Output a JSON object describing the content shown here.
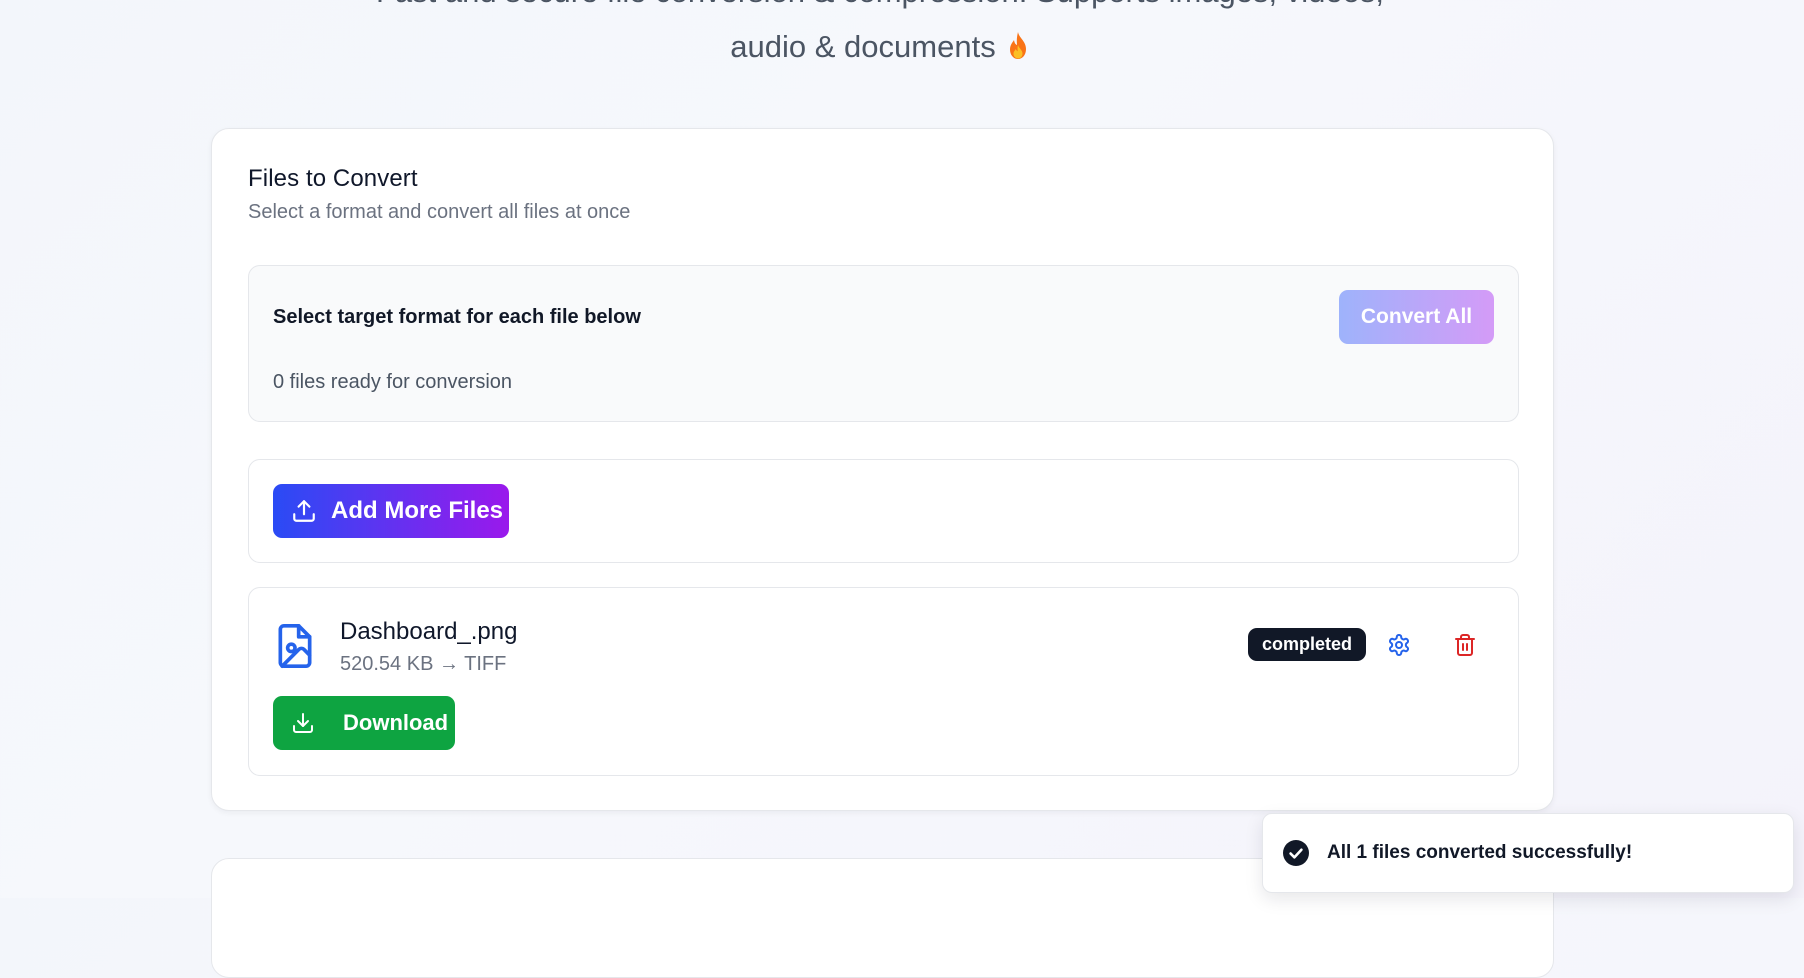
{
  "hero": {
    "subtitle_line1": "Fast and secure file conversion & compression. Supports images, videos,",
    "subtitle_line2": "audio & documents",
    "emoji": "fire-emoji-icon"
  },
  "files_card": {
    "title": "Files to Convert",
    "subtitle": "Select a format and convert all files at once",
    "format_label": "Select target format for each file below",
    "ready_count": "0 files ready for conversion",
    "convert_all_label": "Convert All",
    "add_more_label": "Add More Files"
  },
  "file": {
    "name": "Dashboard_.png",
    "meta": "520.54 KB → TIFF",
    "status": "completed",
    "download_label": "Download",
    "icon": "file-image-icon"
  },
  "toast": {
    "message": "All 1 files converted successfully!",
    "icon": "check-circle-icon"
  },
  "colors": {
    "primary_gradient_start": "#2a4bf5",
    "primary_gradient_end": "#9a19ec",
    "success": "#0ea441",
    "danger": "#dc2626",
    "accent_blue": "#2563eb",
    "badge_dark": "#111827"
  }
}
